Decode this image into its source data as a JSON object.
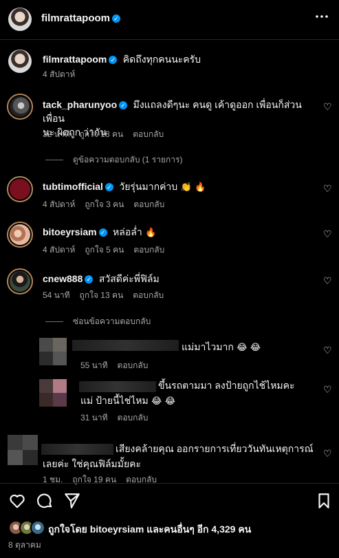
{
  "header": {
    "username": "filmrattapoom",
    "more_icon": "more-horizontal-icon"
  },
  "caption": {
    "username": "filmrattapoom",
    "text": "คิดถึงทุกคนนะครับ",
    "time": "4 สัปดาห์"
  },
  "comments": [
    {
      "username": "tack_pharunyoo",
      "text_line1": "มึงแถลงดีๆนะ คนดู เค้าดูออก เพื่อนก็ส่วนเพื่อน",
      "text_line2": "นะ ผิดถูก ว่ากัน",
      "time": "32 นาที",
      "likes": "ถูกใจ 18 คน",
      "reply": "ตอบกลับ",
      "view_replies": "ดูข้อความตอบกลับ (1 รายการ)"
    },
    {
      "username": "tubtimofficial",
      "text": "วัยรุ่นมากค่าบ",
      "time": "4 สัปดาห์",
      "likes": "ถูกใจ 3 คน",
      "reply": "ตอบกลับ"
    },
    {
      "username": "bitoeyrsiam",
      "text": "หล่อล่ำ",
      "time": "4 สัปดาห์",
      "likes": "ถูกใจ 5 คน",
      "reply": "ตอบกลับ"
    },
    {
      "username": "cnew888",
      "text": "สวัสดีค่ะพี่ฟิล์ม",
      "time": "54 นาที",
      "likes": "ถูกใจ 13 คน",
      "reply": "ตอบกลับ",
      "hide_replies": "ซ่อนข้อความตอบกลับ"
    }
  ],
  "replies": [
    {
      "text": "แม่มาไวมาก",
      "time": "55 นาที",
      "reply": "ตอบกลับ"
    },
    {
      "text_line1": "ขึ้นรถตามมา ลงป้ายถูกไช้ไหมคะ",
      "text_line2": "แม่ ป้ายนี้ไช่ไหม",
      "time": "31 นาที",
      "reply": "ตอบกลับ"
    }
  ],
  "last_comment": {
    "text_line1": "เสียงคล้ายคุณ ออกรายการเที่ยววันทันเหตุการณ์",
    "text_line2": "เลยค่ะ ใช่คุณฟิล์มมั้ยคะ",
    "time": "1 ชม.",
    "likes": "ถูกใจ 19 คน",
    "reply": "ตอบกลับ"
  },
  "footer": {
    "liked_by": "ถูกใจโดย bitoeyrsiam และคนอื่นๆ อีก 4,329 คน",
    "date": "8 ตุลาคม"
  },
  "colors": {
    "background": "#000000",
    "text": "#f5f5f5",
    "secondary": "#a8a8a8",
    "verified": "#0095f6"
  }
}
